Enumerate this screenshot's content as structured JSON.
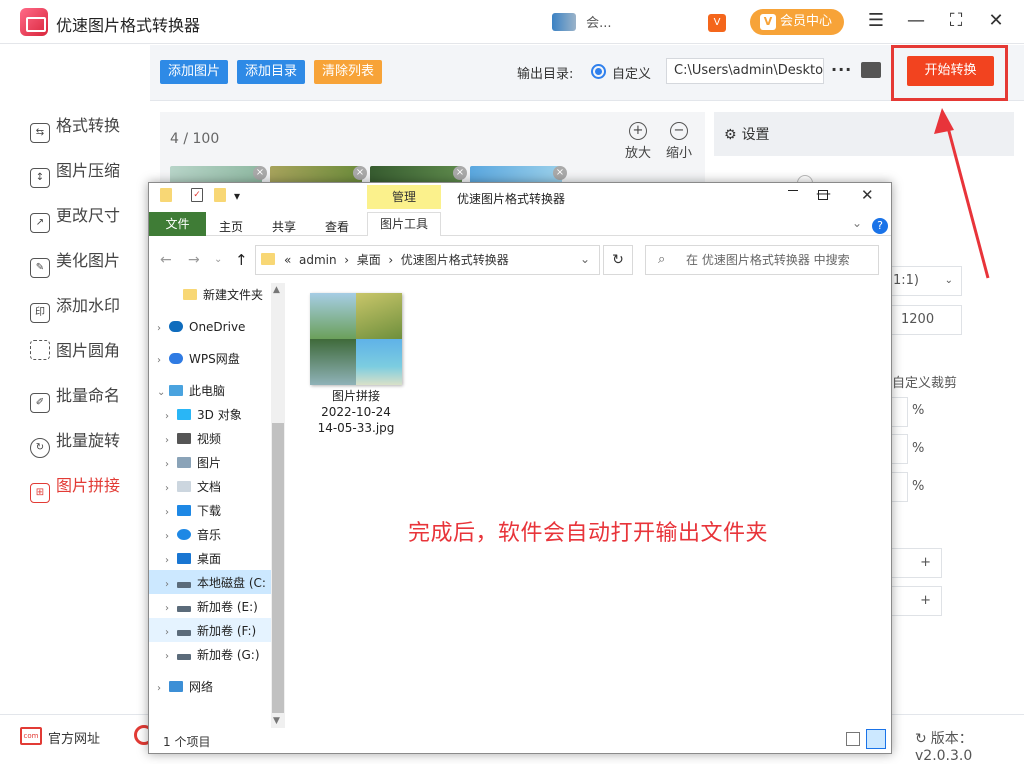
{
  "app": {
    "title": "优速图片格式转换器",
    "user_text": "会...",
    "vip_label": "会员中心"
  },
  "toolbar": {
    "add_image": "添加图片",
    "add_dir": "添加目录",
    "clear_list": "清除列表",
    "output_label": "输出目录:",
    "radio_label": "自定义",
    "output_path": "C:\\Users\\admin\\Deskto",
    "more": "···",
    "start": "开始转换"
  },
  "sidebar": {
    "items": [
      {
        "label": "格式转换",
        "icon": "format-icon"
      },
      {
        "label": "图片压缩",
        "icon": "compress-icon"
      },
      {
        "label": "更改尺寸",
        "icon": "resize-icon"
      },
      {
        "label": "美化图片",
        "icon": "beautify-icon"
      },
      {
        "label": "添加水印",
        "icon": "watermark-icon"
      },
      {
        "label": "图片圆角",
        "icon": "round-corner-icon"
      },
      {
        "label": "批量命名",
        "icon": "rename-icon"
      },
      {
        "label": "批量旋转",
        "icon": "rotate-icon"
      },
      {
        "label": "图片拼接",
        "icon": "stitch-icon",
        "active": true
      }
    ]
  },
  "content": {
    "count": "4 / 100",
    "zoom_in": "放大",
    "zoom_out": "缩小"
  },
  "right_panel": {
    "title": "设置",
    "ratio": "1:1)",
    "width": "1200",
    "crop": "自定义裁剪",
    "pct": "%",
    "plus": "+"
  },
  "footer": {
    "website": "官方网址",
    "version": "版本：v2.0.3.0"
  },
  "explorer": {
    "title": "优速图片格式转换器",
    "ribbon_manage": "管理",
    "tabs": [
      "文件",
      "主页",
      "共享",
      "查看"
    ],
    "picture_tools": "图片工具",
    "breadcrumb": [
      "«",
      "admin",
      "›",
      "桌面",
      "›",
      "优速图片格式转换器"
    ],
    "search_placeholder": "在 优速图片格式转换器 中搜索",
    "nav": [
      {
        "label": "新建文件夹",
        "icon": "folder-icon"
      },
      {
        "label": "OneDrive",
        "icon": "onedrive-icon"
      },
      {
        "label": "WPS网盘",
        "icon": "wps-cloud-icon"
      },
      {
        "label": "此电脑",
        "icon": "pc-icon"
      },
      {
        "label": "3D 对象",
        "icon": "3d-icon"
      },
      {
        "label": "视频",
        "icon": "video-icon"
      },
      {
        "label": "图片",
        "icon": "pictures-icon"
      },
      {
        "label": "文档",
        "icon": "documents-icon"
      },
      {
        "label": "下载",
        "icon": "download-icon"
      },
      {
        "label": "音乐",
        "icon": "music-icon"
      },
      {
        "label": "桌面",
        "icon": "desktop-icon"
      },
      {
        "label": "本地磁盘 (C:",
        "icon": "drive-icon"
      },
      {
        "label": "新加卷 (E:)",
        "icon": "drive-icon"
      },
      {
        "label": "新加卷 (F:)",
        "icon": "drive-icon"
      },
      {
        "label": "新加卷 (G:)",
        "icon": "drive-icon"
      },
      {
        "label": "网络",
        "icon": "network-icon"
      }
    ],
    "file": {
      "line1": "图片拼接",
      "line2": "2022-10-24",
      "line3": "14-05-33.jpg"
    },
    "status": "1 个项目"
  },
  "annotation": "完成后，软件会自动打开输出文件夹",
  "colors": {
    "accent_red": "#e23b35",
    "start_button": "#f2431f",
    "blue_btn": "#2e8ae6",
    "orange_btn": "#f7a338"
  }
}
